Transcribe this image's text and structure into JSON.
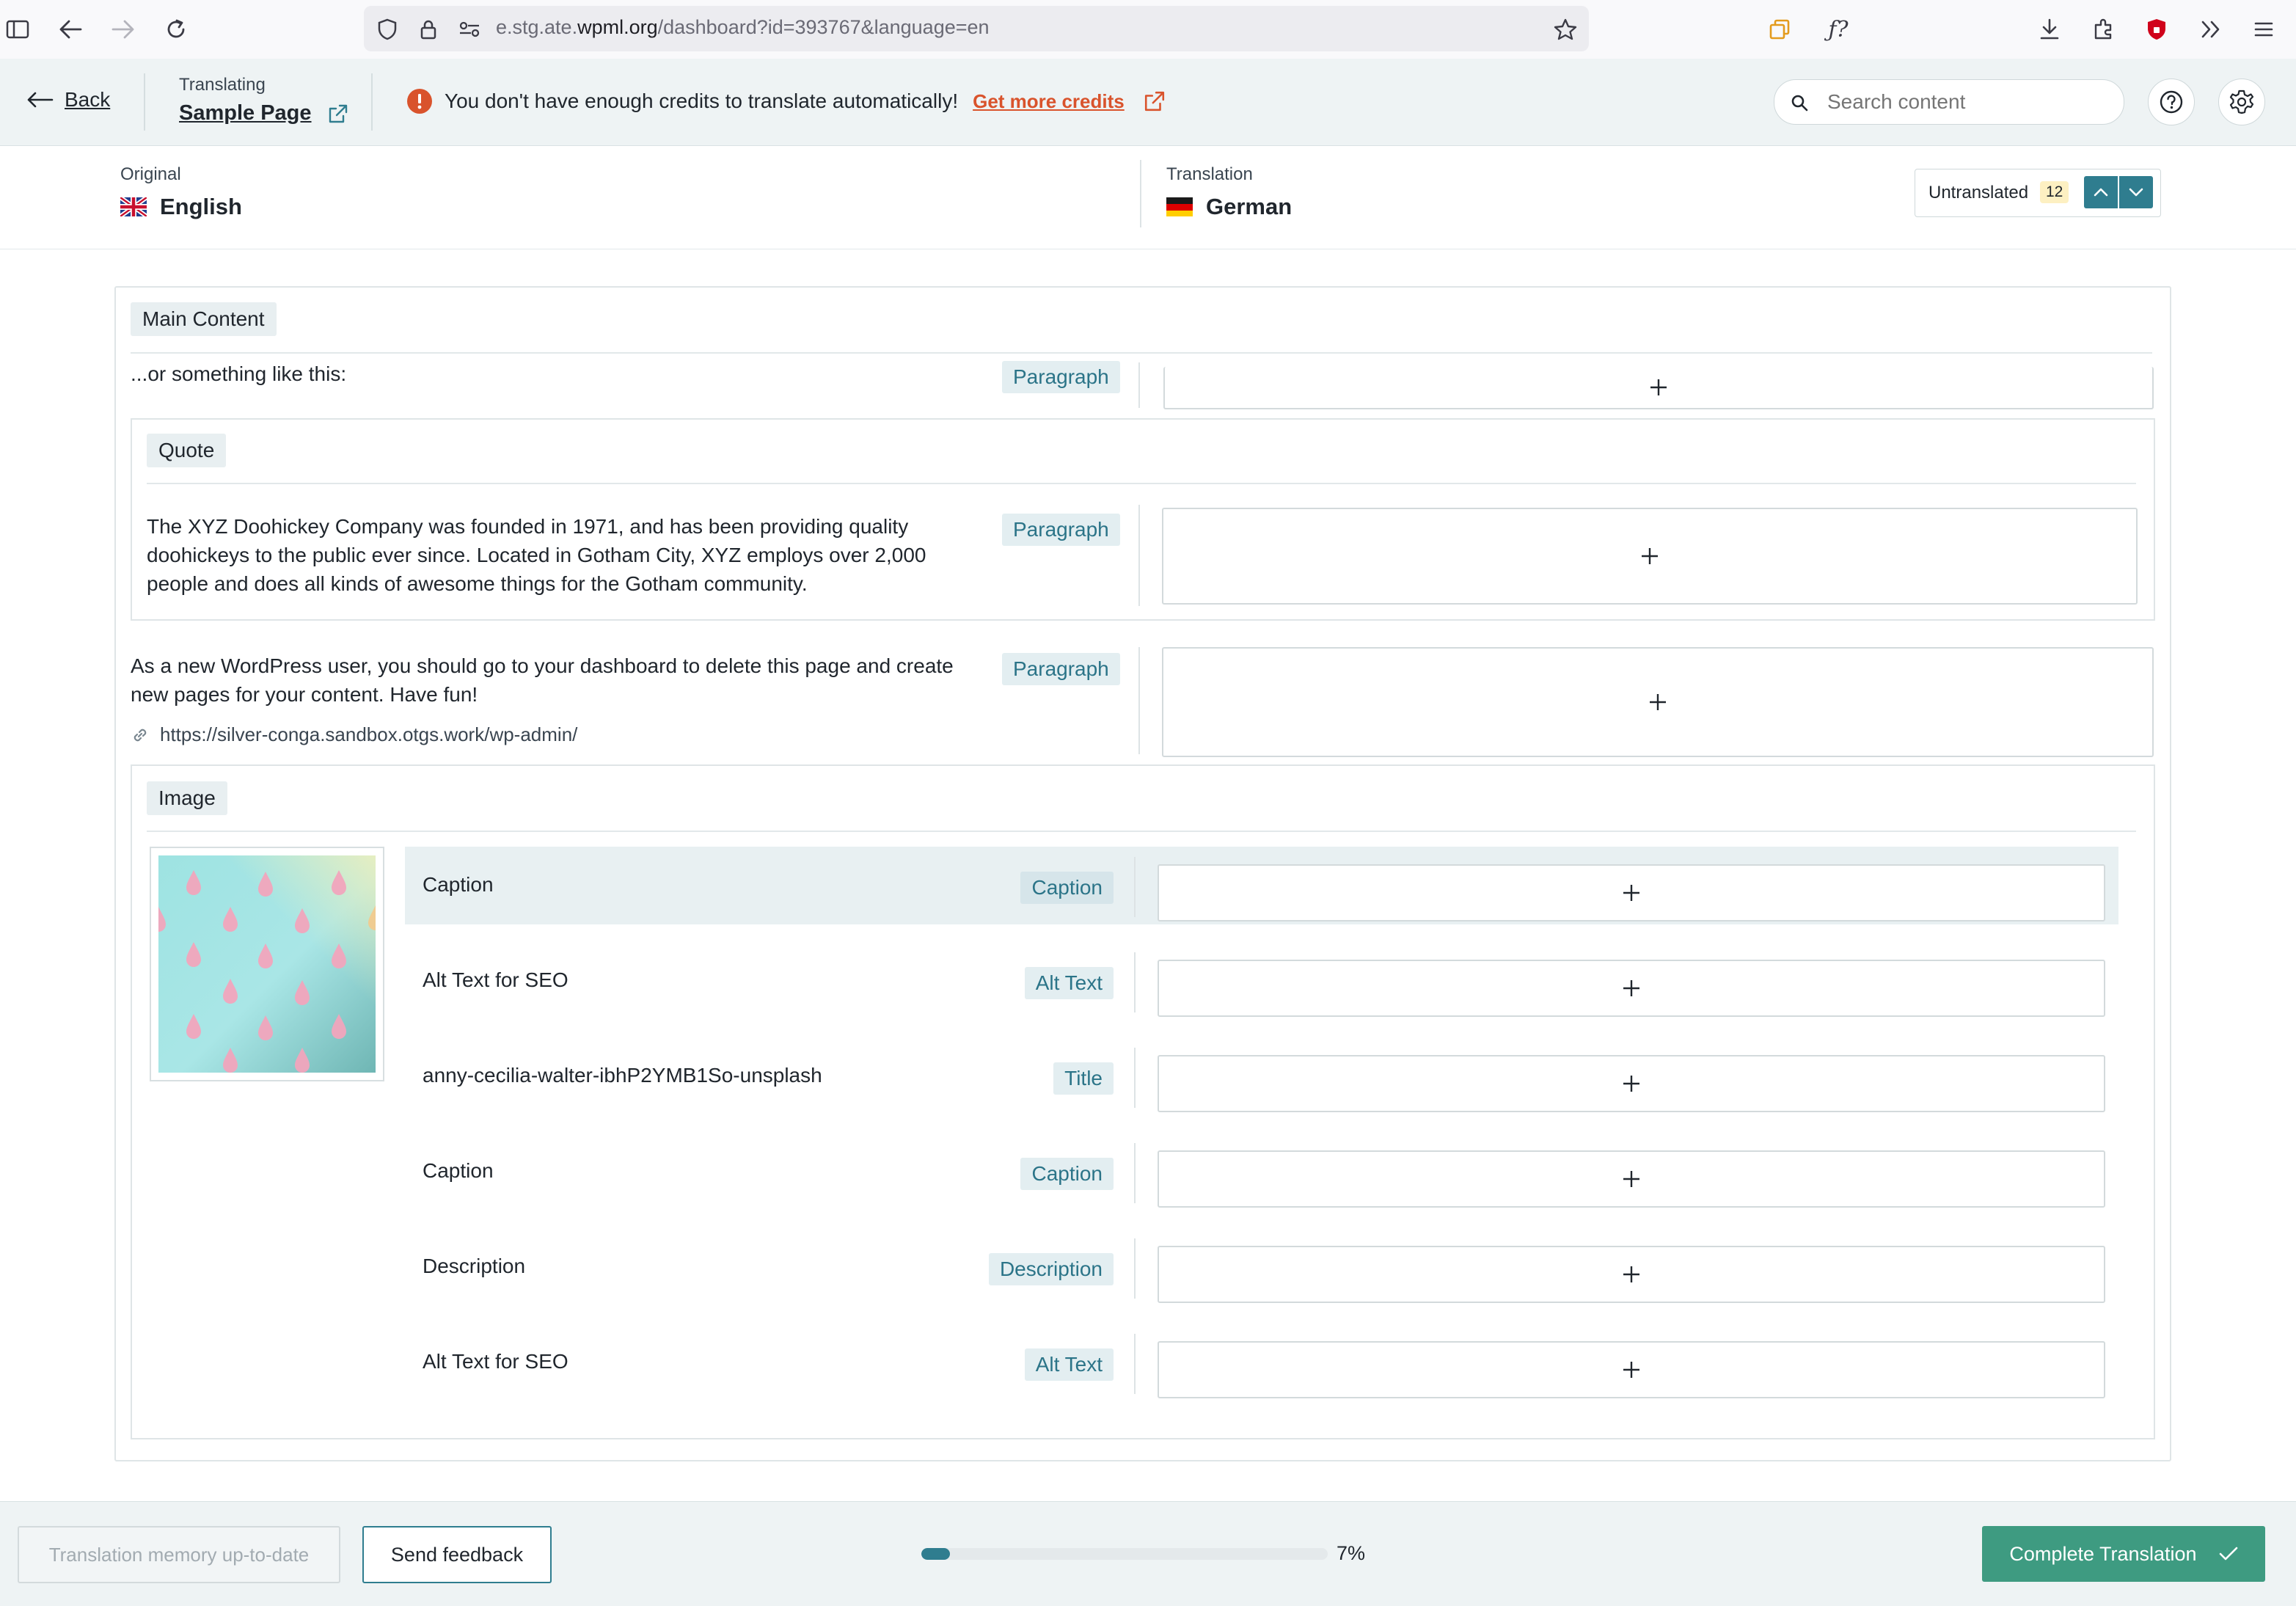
{
  "browser": {
    "url_prefix": "e.stg.ate.",
    "url_domain": "wpml.org",
    "url_path": "/dashboard?id=393767&language=en"
  },
  "header": {
    "back_label": "Back",
    "translating_label": "Translating",
    "page_name": "Sample Page",
    "credits_warning": "You don't have enough credits to translate automatically!",
    "get_credits_label": "Get more credits",
    "search_placeholder": "Search content"
  },
  "languages": {
    "original_label": "Original",
    "original_name": "English",
    "translation_label": "Translation",
    "translation_name": "German",
    "filter_label": "Untranslated",
    "filter_count": "12"
  },
  "content": {
    "main_section": "Main Content",
    "row1_text": "...or something like this:",
    "row1_type": "Paragraph",
    "quote_section": "Quote",
    "quote_text": "The XYZ Doohickey Company was founded in 1971, and has been providing quality doohickeys to the public ever since. Located in Gotham City, XYZ employs over 2,000 people and does all kinds of awesome things for the Gotham community.",
    "quote_type": "Paragraph",
    "para_text": "As a new WordPress user, you should go to your dashboard to delete this page and create new pages for your content. Have fun!",
    "para_type": "Paragraph",
    "para_link": "https://silver-conga.sandbox.otgs.work/wp-admin/",
    "image_section": "Image",
    "image_rows": [
      {
        "text": "Caption",
        "type": "Caption"
      },
      {
        "text": "Alt Text for SEO",
        "type": "Alt Text"
      },
      {
        "text": "anny-cecilia-walter-ibhP2YMB1So-unsplash",
        "type": "Title"
      },
      {
        "text": "Caption",
        "type": "Caption"
      },
      {
        "text": "Description",
        "type": "Description"
      },
      {
        "text": "Alt Text for SEO",
        "type": "Alt Text"
      }
    ]
  },
  "footer": {
    "memory_label": "Translation memory up-to-date",
    "feedback_label": "Send feedback",
    "progress_percent": "7%",
    "progress_fraction": 0.07,
    "complete_label": "Complete Translation"
  },
  "colors": {
    "accent": "#2f7d8f",
    "complete_button": "#3e9b81",
    "warning": "#d9532c",
    "badge_text": "#2b7488"
  }
}
